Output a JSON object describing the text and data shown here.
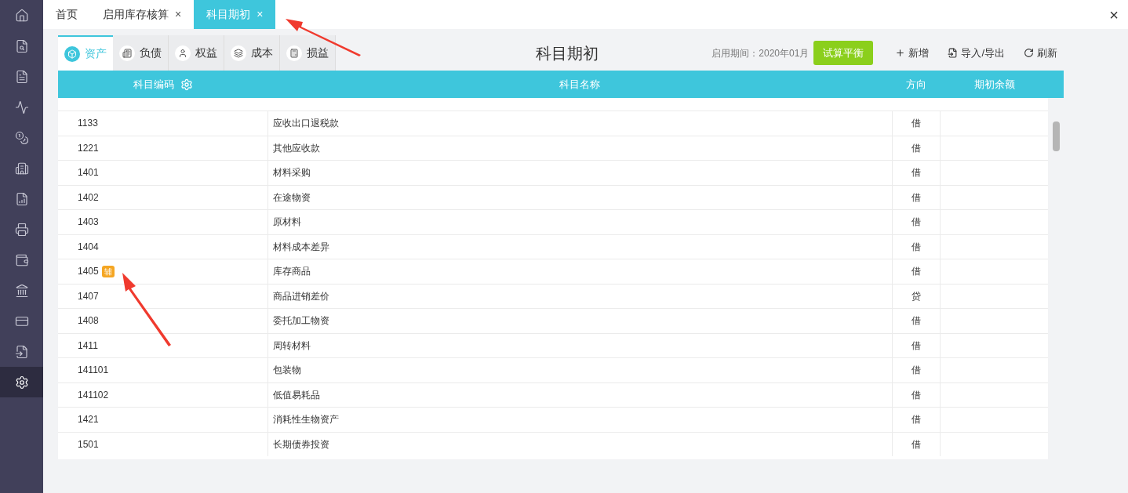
{
  "tabs": [
    {
      "label": "首页",
      "selected": false
    },
    {
      "label": "启用库存核算",
      "selected": false,
      "close": "×"
    },
    {
      "label": "科目期初",
      "selected": true,
      "close": "×"
    }
  ],
  "window_close": "×",
  "category_tabs": [
    {
      "label": "资产",
      "selected": true
    },
    {
      "label": "负债",
      "selected": false
    },
    {
      "label": "权益",
      "selected": false
    },
    {
      "label": "成本",
      "selected": false
    },
    {
      "label": "损益",
      "selected": false
    }
  ],
  "page_title": "科目期初",
  "period": "启用期间：2020年01月",
  "trial_balance_button": "试算平衡",
  "actions": [
    {
      "kind": "add",
      "label": "新增"
    },
    {
      "kind": "import",
      "label": "导入/导出"
    },
    {
      "kind": "refresh",
      "label": "刷新"
    }
  ],
  "table": {
    "columns": [
      "科目编码",
      "科目名称",
      "方向",
      "期初余额"
    ],
    "rows": [
      {
        "code": "1133",
        "name": "应收出口退税款",
        "direction": "借"
      },
      {
        "code": "1221",
        "name": "其他应收款",
        "direction": "借"
      },
      {
        "code": "1401",
        "name": "材料采购",
        "direction": "借"
      },
      {
        "code": "1402",
        "name": "在途物资",
        "direction": "借"
      },
      {
        "code": "1403",
        "name": "原材料",
        "direction": "借"
      },
      {
        "code": "1404",
        "name": "材料成本差异",
        "direction": "借"
      },
      {
        "code": "1405",
        "badge": "辅",
        "name": "库存商品",
        "direction": "借"
      },
      {
        "code": "1407",
        "name": "商品进销差价",
        "direction": "贷"
      },
      {
        "code": "1408",
        "name": "委托加工物资",
        "direction": "借"
      },
      {
        "code": "1411",
        "name": "周转材料",
        "direction": "借"
      },
      {
        "code": "141101",
        "name": "包装物",
        "direction": "借"
      },
      {
        "code": "141102",
        "name": "低值易耗品",
        "direction": "借"
      },
      {
        "code": "1421",
        "name": "消耗性生物资产",
        "direction": "借"
      },
      {
        "code": "1501",
        "name": "长期债券投资",
        "direction": "借"
      }
    ]
  }
}
